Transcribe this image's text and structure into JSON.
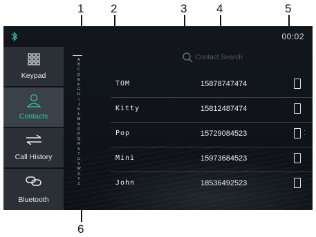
{
  "callouts": [
    "1",
    "2",
    "3",
    "4",
    "5",
    "6"
  ],
  "status_bar": {
    "time": "00:02"
  },
  "sidebar": {
    "items": [
      {
        "label": "Keypad",
        "icon": "keypad-icon"
      },
      {
        "label": "Contacts",
        "icon": "contacts-icon"
      },
      {
        "label": "Call History",
        "icon": "call-history-icon"
      },
      {
        "label": "Bluetooth",
        "icon": "bluetooth-link-icon"
      }
    ]
  },
  "alphabet": [
    "A",
    "B",
    "C",
    "D",
    "E",
    "F",
    "G",
    "H",
    "I",
    "J",
    "K",
    "L",
    "M",
    "N",
    "O",
    "P",
    "Q",
    "R",
    "S",
    "T",
    "U",
    "V",
    "W",
    "X",
    "Y",
    "Z"
  ],
  "highlighted_letter": "T",
  "search": {
    "placeholder": "Contact Search"
  },
  "contacts": [
    {
      "name": "TOM",
      "number": "15878747474"
    },
    {
      "name": "Kitty",
      "number": "15812487474"
    },
    {
      "name": "Pop",
      "number": "15729084523"
    },
    {
      "name": "Mini",
      "number": "15973684523"
    },
    {
      "name": "John",
      "number": "18536492523"
    }
  ],
  "colors": {
    "accent": "#35c7a4",
    "highlight": "#3ee6c4",
    "screen_bg": "#0f1418",
    "sidebar_bg": "#2b3036",
    "sidebar_active_bg": "#3b4148"
  }
}
